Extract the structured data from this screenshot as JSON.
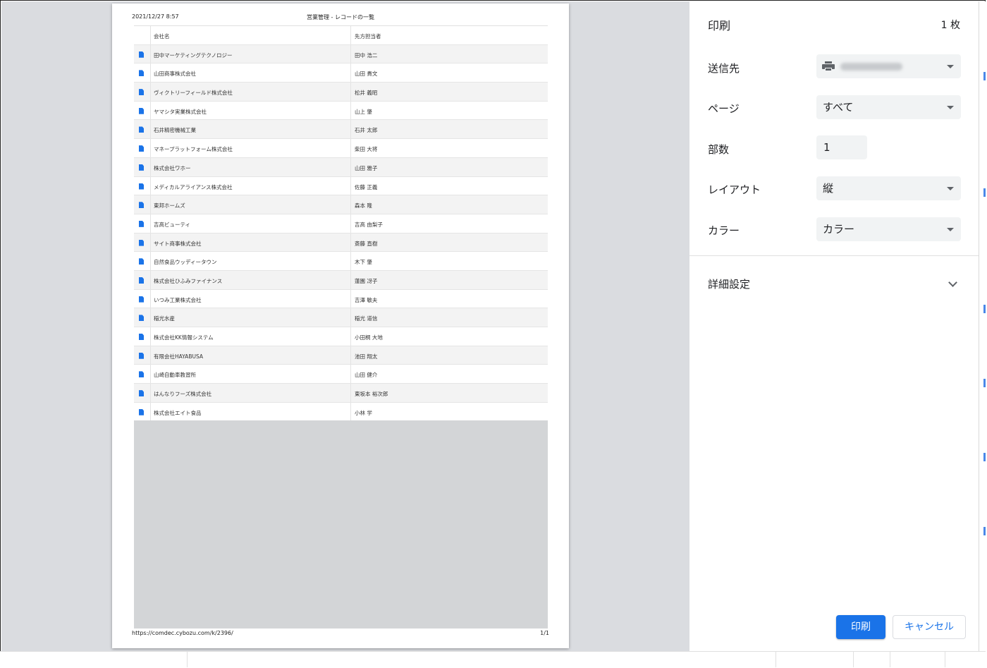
{
  "preview": {
    "date": "2021/12/27 8:57",
    "title": "営業管理 - レコードの一覧",
    "url": "https://comdec.cybozu.com/k/2396/",
    "page_num": "1/1",
    "columns": {
      "company": "会社名",
      "contact": "先方担当者"
    },
    "rows": [
      {
        "company": "田中マーケティングテクノロジー",
        "contact": "田中 浩二"
      },
      {
        "company": "山田商事株式会社",
        "contact": "山田 貴文"
      },
      {
        "company": "ヴィクトリーフィールド株式会社",
        "contact": "松井 義昭"
      },
      {
        "company": "ヤマシタ実業株式会社",
        "contact": "山上 肇"
      },
      {
        "company": "石井精密機械工業",
        "contact": "石井 太郎"
      },
      {
        "company": "マネープラットフォーム株式会社",
        "contact": "柴田 大将"
      },
      {
        "company": "株式会社ワホー",
        "contact": "山田 雅子"
      },
      {
        "company": "メディカルアライアンス株式会社",
        "contact": "佐藤 正義"
      },
      {
        "company": "東邦ホームズ",
        "contact": "森本 隆"
      },
      {
        "company": "吉高ビューティ",
        "contact": "吉高 由梨子"
      },
      {
        "company": "サイト商事株式会社",
        "contact": "斎藤 直樹"
      },
      {
        "company": "自然食品ウッディータウン",
        "contact": "木下 肇"
      },
      {
        "company": "株式会社ひふみファイナンス",
        "contact": "蓮園 冴子"
      },
      {
        "company": "いつみ工業株式会社",
        "contact": "吉澤 敏夫"
      },
      {
        "company": "稲光水産",
        "contact": "稲光 道信"
      },
      {
        "company": "株式会社KK情報システム",
        "contact": "小田桐 大地"
      },
      {
        "company": "有限会社HAYABUSA",
        "contact": "池田 翔太"
      },
      {
        "company": "山崎自動車教習所",
        "contact": "山田 健介"
      },
      {
        "company": "はんなりフーズ株式会社",
        "contact": "東坂本 裕次郎"
      },
      {
        "company": "株式会社エイト食品",
        "contact": "小林 学"
      }
    ]
  },
  "settings": {
    "title": "印刷",
    "sheet_count": "1 枚",
    "destination": {
      "label": "送信先",
      "icon": "printer-icon"
    },
    "pages": {
      "label": "ページ",
      "value": "すべて"
    },
    "copies": {
      "label": "部数",
      "value": "1"
    },
    "layout": {
      "label": "レイアウト",
      "value": "縦"
    },
    "color": {
      "label": "カラー",
      "value": "カラー"
    },
    "more_settings": "詳細設定",
    "print_button": "印刷",
    "cancel_button": "キャンセル"
  },
  "colors": {
    "accent": "#1a73e8",
    "doc_icon": "#1a73e8",
    "preview_bg": "#dadce0",
    "field_bg": "#f1f3f4"
  }
}
